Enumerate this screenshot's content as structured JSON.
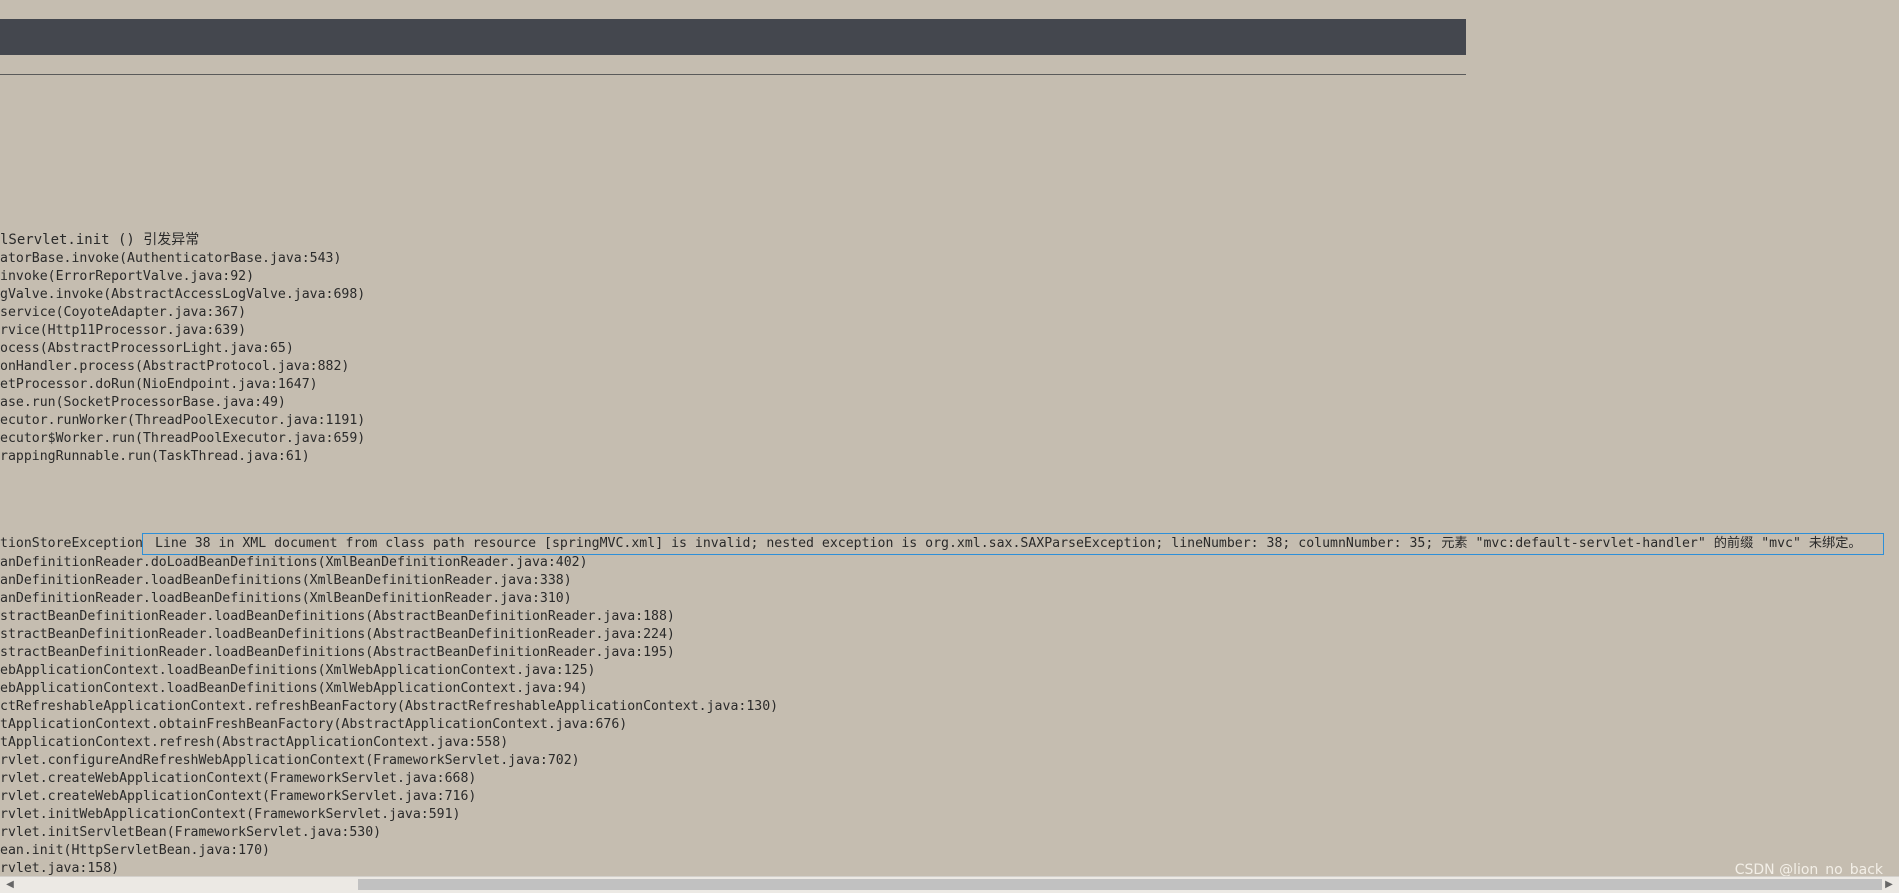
{
  "root_cause_header": "lServlet.init () 引发异常",
  "root_cause_stack": [
    "atorBase.invoke(AuthenticatorBase.java:543)",
    "invoke(ErrorReportValve.java:92)",
    "gValve.invoke(AbstractAccessLogValve.java:698)",
    "service(CoyoteAdapter.java:367)",
    "rvice(Http11Processor.java:639)",
    "ocess(AbstractProcessorLight.java:65)",
    "onHandler.process(AbstractProtocol.java:882)",
    "etProcessor.doRun(NioEndpoint.java:1647)",
    "ase.run(SocketProcessorBase.java:49)",
    "ecutor.runWorker(ThreadPoolExecutor.java:1191)",
    "ecutor$Worker.run(ThreadPoolExecutor.java:659)",
    "rappingRunnable.run(TaskThread.java:61)"
  ],
  "exception_class": "tionStoreException",
  "exception_message": "Line 38 in XML document from class path resource [springMVC.xml] is invalid; nested exception is org.xml.sax.SAXParseException; lineNumber: 38; columnNumber: 35; 元素 \"mvc:default-servlet-handler\" 的前缀 \"mvc\" 未绑定。",
  "exception_stack": [
    "anDefinitionReader.doLoadBeanDefinitions(XmlBeanDefinitionReader.java:402)",
    "anDefinitionReader.loadBeanDefinitions(XmlBeanDefinitionReader.java:338)",
    "anDefinitionReader.loadBeanDefinitions(XmlBeanDefinitionReader.java:310)",
    "stractBeanDefinitionReader.loadBeanDefinitions(AbstractBeanDefinitionReader.java:188)",
    "stractBeanDefinitionReader.loadBeanDefinitions(AbstractBeanDefinitionReader.java:224)",
    "stractBeanDefinitionReader.loadBeanDefinitions(AbstractBeanDefinitionReader.java:195)",
    "ebApplicationContext.loadBeanDefinitions(XmlWebApplicationContext.java:125)",
    "ebApplicationContext.loadBeanDefinitions(XmlWebApplicationContext.java:94)",
    "ctRefreshableApplicationContext.refreshBeanFactory(AbstractRefreshableApplicationContext.java:130)",
    "tApplicationContext.obtainFreshBeanFactory(AbstractApplicationContext.java:676)",
    "tApplicationContext.refresh(AbstractApplicationContext.java:558)",
    "rvlet.configureAndRefreshWebApplicationContext(FrameworkServlet.java:702)",
    "rvlet.createWebApplicationContext(FrameworkServlet.java:668)",
    "rvlet.createWebApplicationContext(FrameworkServlet.java:716)",
    "rvlet.initWebApplicationContext(FrameworkServlet.java:591)",
    "rvlet.initServletBean(FrameworkServlet.java:530)",
    "ean.init(HttpServletBean.java:170)",
    "rvlet.java:158)"
  ],
  "watermark": "CSDN @lion_no_back",
  "scrollbar": {
    "left_arrow": "◀",
    "right_arrow": "▶"
  }
}
